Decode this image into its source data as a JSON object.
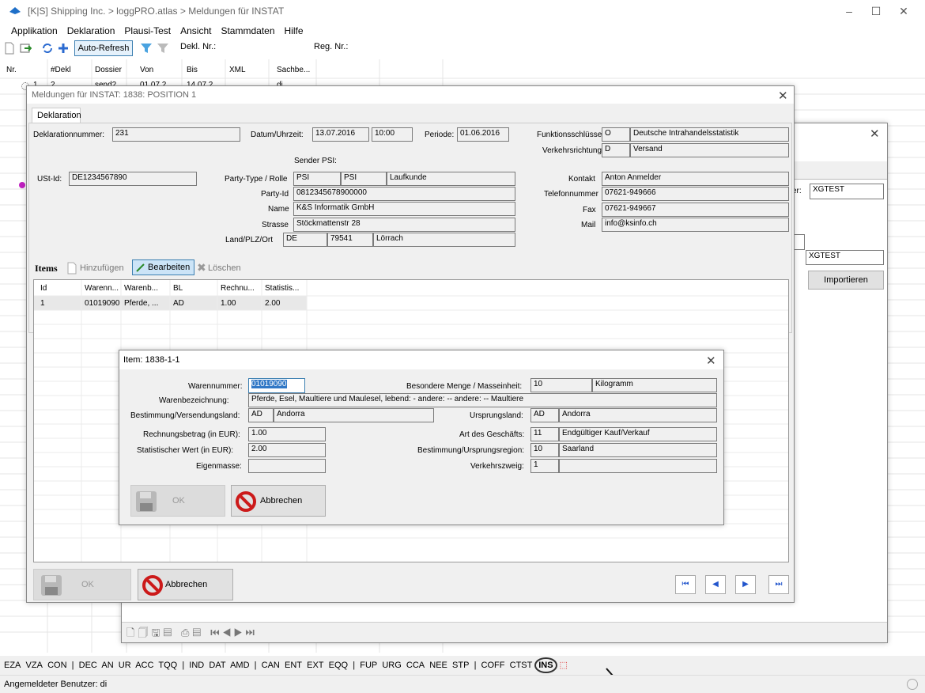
{
  "window": {
    "title": "[K|S] Shipping Inc. > loggPRO.atlas > Meldungen für INSTAT"
  },
  "menu": [
    "Applikation",
    "Deklaration",
    "Plausi-Test",
    "Ansicht",
    "Stammdaten",
    "Hilfe"
  ],
  "toolbar": {
    "auto_refresh": "Auto-Refresh",
    "dekl_nr_label": "Dekl. Nr.:",
    "reg_nr_label": "Reg. Nr.:"
  },
  "main_grid": {
    "headers": [
      "Nr.",
      "#Dekl",
      "Dossier",
      "Von",
      "Bis",
      "XML",
      "Sachbe..."
    ],
    "row": [
      "1",
      "2",
      "send2",
      "01.07.2",
      "14.07.2",
      "",
      "di"
    ]
  },
  "back_dialog": {
    "label_suffix": "er:",
    "value1": "XGTEST",
    "value2": "XGTEST",
    "import_button": "Importieren"
  },
  "dlg1": {
    "title": "Meldungen für INSTAT: 1838: POSITION 1",
    "tab": "Deklaration",
    "deklarationsnummer_label": "Deklarationnummer:",
    "deklarationsnummer": "231",
    "datum_label": "Datum/Uhrzeit:",
    "datum": "13.07.2016",
    "uhrzeit": "10:00",
    "periode_label": "Periode:",
    "periode": "01.06.2016",
    "funktion_label": "Funktionsschlüssel:",
    "funktion_code": "O",
    "funktion_text": "Deutsche Intrahandelsstatistik",
    "verkehr_label": "Verkehrsrichtung:",
    "verkehr_code": "D",
    "verkehr_text": "Versand",
    "sender_label": "Sender PSI:",
    "ustid_label": "USt-Id:",
    "ustid": "DE1234567890",
    "party_label": "Party-Type / Rolle",
    "party_type": "PSI",
    "party_role": "PSI",
    "party_role_text": "Laufkunde",
    "partyid_label": "Party-Id",
    "partyid": "0812345678900000",
    "name_label": "Name",
    "name": "K&S Informatik GmbH",
    "strasse_label": "Strasse",
    "strasse": "Stöckmattenstr 28",
    "land_label": "Land/PLZ/Ort",
    "land": "DE",
    "plz": "79541",
    "ort": "Lörrach",
    "kontakt_label": "Kontakt",
    "kontakt": "Anton Anmelder",
    "tel_label": "Telefonnummer",
    "tel": "07621-949666",
    "fax_label": "Fax",
    "fax": "07621-949667",
    "mail_label": "Mail",
    "mail": "info@ksinfo.ch",
    "items_label": "Items",
    "add": "Hinzufügen",
    "edit": "Bearbeiten",
    "delete": "Löschen",
    "items_headers": [
      "Id",
      "Warenn...",
      "Warenb...",
      "BL",
      "Rechnu...",
      "Statistis..."
    ],
    "items_row": [
      "1",
      "01019090",
      "Pferde, ...",
      "AD",
      "1.00",
      "2.00"
    ],
    "ok": "OK",
    "cancel": "Abbrechen"
  },
  "dlg2": {
    "title": "Item: 1838-1-1",
    "warennummer_label": "Warennummer:",
    "warennummer": "01019090",
    "menge_label": "Besondere Menge / Masseinheit:",
    "menge": "10",
    "einheit": "Kilogramm",
    "bez_label": "Warenbezeichnung:",
    "bez": "Pferde, Esel, Maultiere und Maulesel, lebend: - andere: -- andere: -- Maultiere",
    "best_label": "Bestimmung/Versendungsland:",
    "best_code": "AD",
    "best_text": "Andorra",
    "urs_label": "Ursprungsland:",
    "urs_code": "AD",
    "urs_text": "Andorra",
    "rech_label": "Rechnungsbetrag (in EUR):",
    "rech": "1.00",
    "art_label": "Art des Geschäfts:",
    "art_code": "11",
    "art_text": "Endgültiger Kauf/Verkauf",
    "stat_label": "Statistischer Wert (in EUR):",
    "stat": "2.00",
    "region_label": "Bestimmung/Ursprungsregion:",
    "region_code": "10",
    "region_text": "Saarland",
    "eigen_label": "Eigenmasse:",
    "eigen": "",
    "vz_label": "Verkehrszweig:",
    "vz_code": "1",
    "vz_text": "",
    "ok": "OK",
    "cancel": "Abbrechen"
  },
  "modules": [
    "EZA",
    "VZA",
    "CON",
    "|",
    "DEC",
    "AN",
    "UR",
    "ACC",
    "TQQ",
    "|",
    "IND",
    "DAT",
    "AMD",
    "|",
    "CAN",
    "ENT",
    "EXT",
    "EQQ",
    "|",
    "FUP",
    "URG",
    "CCA",
    "NEE",
    "STP",
    "|",
    "COFF",
    "CTST",
    "INS"
  ],
  "statusbar": {
    "user": "Angemeldeter Benutzer: di"
  }
}
